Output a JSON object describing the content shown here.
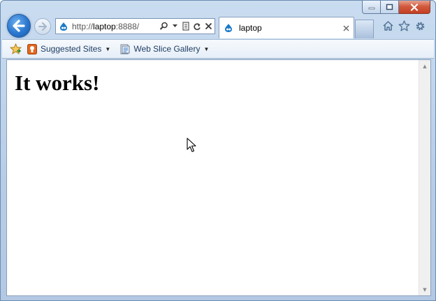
{
  "address_bar": {
    "url_prefix": "http://",
    "url_host": "laptop",
    "url_suffix": ":8888/"
  },
  "tab": {
    "title": "laptop"
  },
  "favorites_bar": {
    "items": [
      {
        "label": "Suggested Sites",
        "icon": "suggested-sites-icon"
      },
      {
        "label": "Web Slice Gallery",
        "icon": "web-slice-icon"
      }
    ]
  },
  "page": {
    "heading": "It works!"
  },
  "colors": {
    "frame": "#b7cde6",
    "accent": "#2a77d0",
    "close": "#c43f22"
  }
}
